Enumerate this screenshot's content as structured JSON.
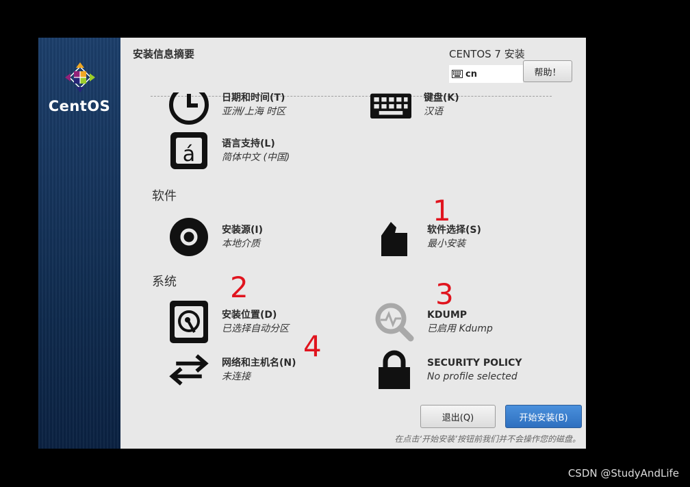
{
  "app": {
    "logo_text": "CentOS",
    "header_title": "安装信息摘要",
    "header_right": "CENTOS 7 安装",
    "keyboard_layout": "cn",
    "help_label": "帮助！"
  },
  "spokes": {
    "datetime": {
      "title": "日期和时间(T)",
      "status": "亚洲/上海 时区"
    },
    "keyboard": {
      "title": "键盘(K)",
      "status": "汉语"
    },
    "language": {
      "title": "语言支持(L)",
      "status": "简体中文 (中国)"
    },
    "source": {
      "title": "安装源(I)",
      "status": "本地介质"
    },
    "software": {
      "title": "软件选择(S)",
      "status": "最小安装"
    },
    "destination": {
      "title": "安装位置(D)",
      "status": "已选择自动分区"
    },
    "kdump": {
      "title": "KDUMP",
      "status": "已启用 Kdump"
    },
    "network": {
      "title": "网络和主机名(N)",
      "status": "未连接"
    },
    "security": {
      "title": "SECURITY POLICY",
      "status": "No profile selected"
    }
  },
  "sections": {
    "software": "软件",
    "system": "系统"
  },
  "annotations": [
    "1",
    "2",
    "3",
    "4"
  ],
  "buttons": {
    "quit": "退出(Q)",
    "begin": "开始安装(B)"
  },
  "footer_note": "在点击‘开始安装’按钮前我们并不会操作您的磁盘。",
  "watermark": "CSDN @StudyAndLife",
  "colors": {
    "annotation": "#e0141e",
    "begin_button": "#3a7fcf",
    "sidebar": "#16355d"
  }
}
